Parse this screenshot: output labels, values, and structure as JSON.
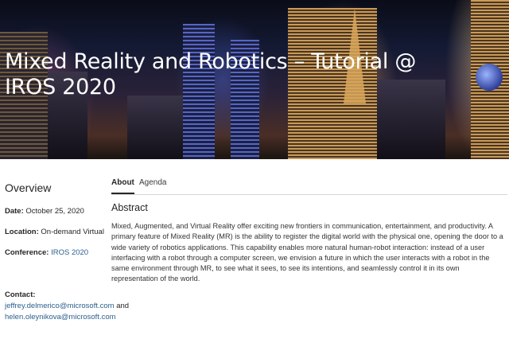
{
  "hero": {
    "title": "Mixed Reality and Robotics – Tutorial @ IROS 2020"
  },
  "sidebar": {
    "heading": "Overview",
    "date_label": "Date:",
    "date_value": "October 25, 2020",
    "location_label": "Location:",
    "location_value": "On-demand Virtual",
    "conference_label": "Conference:",
    "conference_value": "IROS 2020"
  },
  "contact": {
    "label": "Contact:",
    "email1": "jeffrey.delmerico@microsoft.com",
    "joiner": " and",
    "email2": "helen.oleynikova@microsoft.com"
  },
  "tabs": [
    {
      "label": "About",
      "active": true
    },
    {
      "label": "Agenda",
      "active": false
    }
  ],
  "main": {
    "section_title": "Abstract",
    "abstract": "Mixed, Augmented, and Virtual Reality offer exciting new frontiers in communication, entertainment, and productivity. A primary feature of Mixed Reality (MR) is the ability to register the digital world with the physical one, opening the door to a wide variety of robotics applications. This capability enables more natural human-robot interaction: instead of a user interfacing with a robot through a computer screen, we envision a future in which the user interacts with a robot in the same environment through MR, to see what it sees, to see its intentions, and seamlessly control it in its own representation of the world."
  },
  "colors": {
    "link": "#2a5f8e",
    "text": "#262626",
    "divider": "#d6d6d6"
  }
}
